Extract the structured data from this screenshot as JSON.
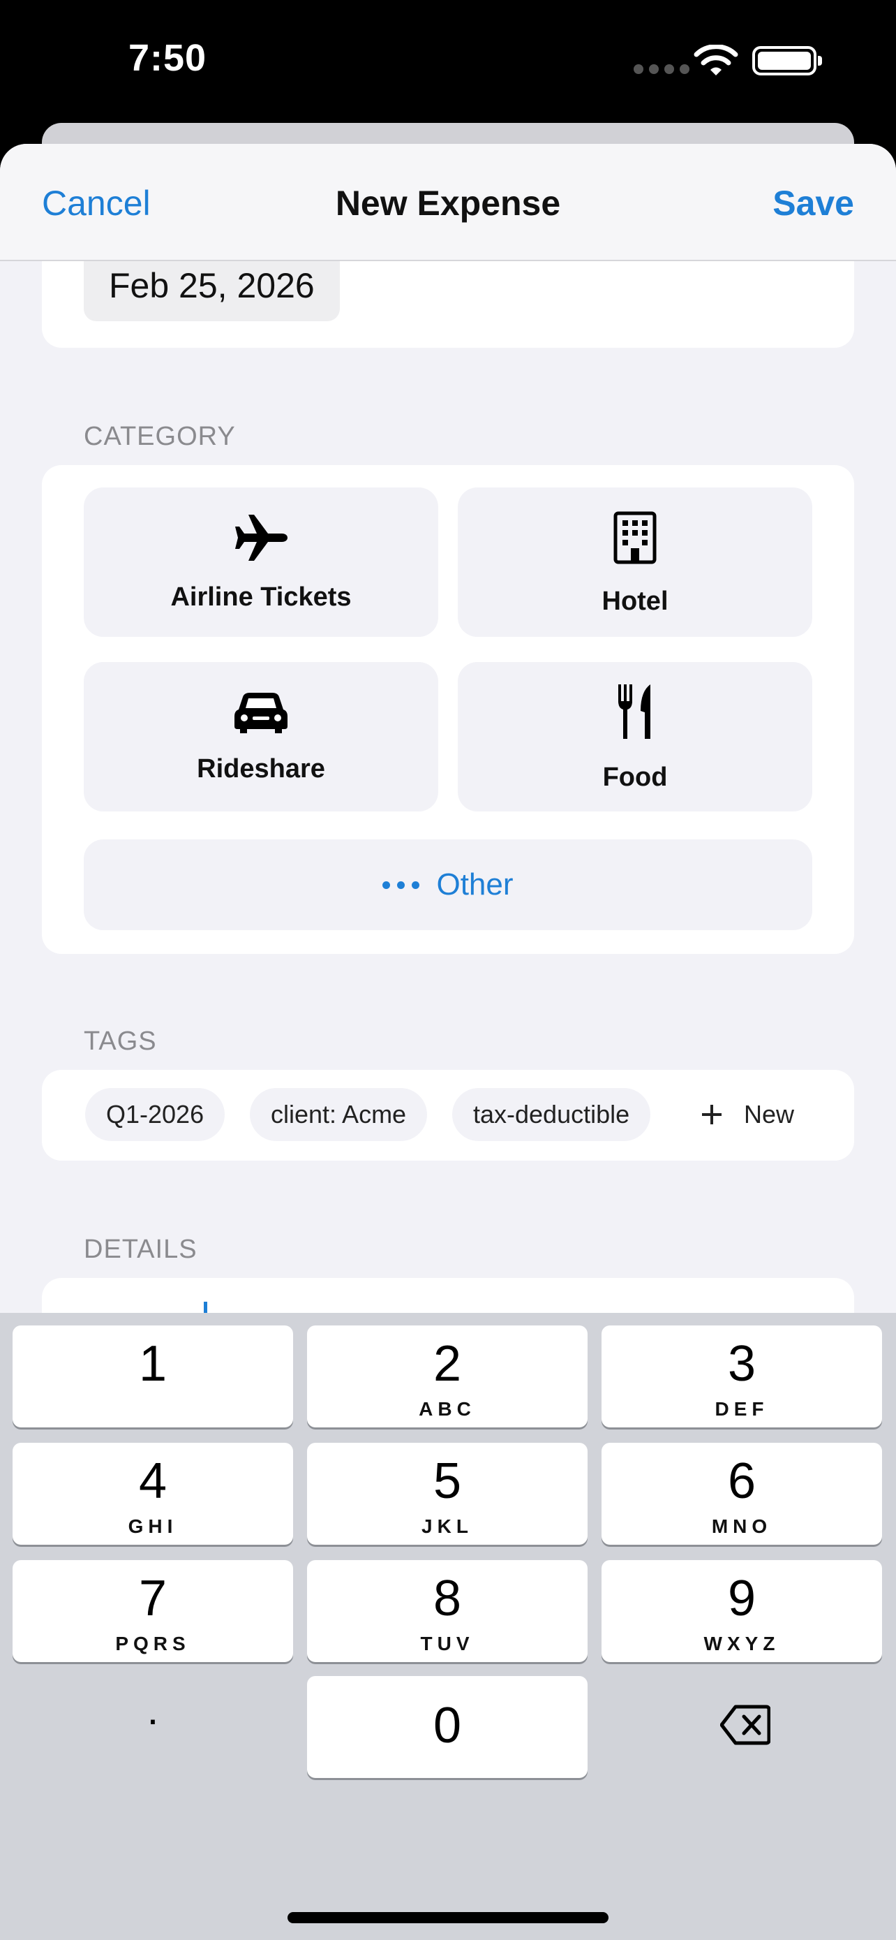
{
  "status_bar": {
    "time": "7:50"
  },
  "nav": {
    "cancel_label": "Cancel",
    "title": "New Expense",
    "save_label": "Save"
  },
  "date": {
    "value": "Feb 25, 2026"
  },
  "category": {
    "section_label": "CATEGORY",
    "items": [
      {
        "label": "Airline Tickets",
        "icon": "airplane-icon"
      },
      {
        "label": "Hotel",
        "icon": "building-icon"
      },
      {
        "label": "Rideshare",
        "icon": "car-icon"
      },
      {
        "label": "Food",
        "icon": "fork-knife-icon"
      }
    ],
    "other_label": "Other"
  },
  "tags": {
    "section_label": "TAGS",
    "items": [
      "Q1-2026",
      "client: Acme",
      "tax-deductible"
    ],
    "new_label": "New"
  },
  "details": {
    "section_label": "DETAILS"
  },
  "keypad": {
    "keys": [
      {
        "num": "1",
        "letters": ""
      },
      {
        "num": "2",
        "letters": "ABC"
      },
      {
        "num": "3",
        "letters": "DEF"
      },
      {
        "num": "4",
        "letters": "GHI"
      },
      {
        "num": "5",
        "letters": "JKL"
      },
      {
        "num": "6",
        "letters": "MNO"
      },
      {
        "num": "7",
        "letters": "PQRS"
      },
      {
        "num": "8",
        "letters": "TUV"
      },
      {
        "num": "9",
        "letters": "WXYZ"
      }
    ],
    "decimal": ".",
    "zero": "0"
  },
  "colors": {
    "accent": "#1e7fd6",
    "background": "#f2f2f7",
    "keyboard": "#d1d3d9"
  }
}
